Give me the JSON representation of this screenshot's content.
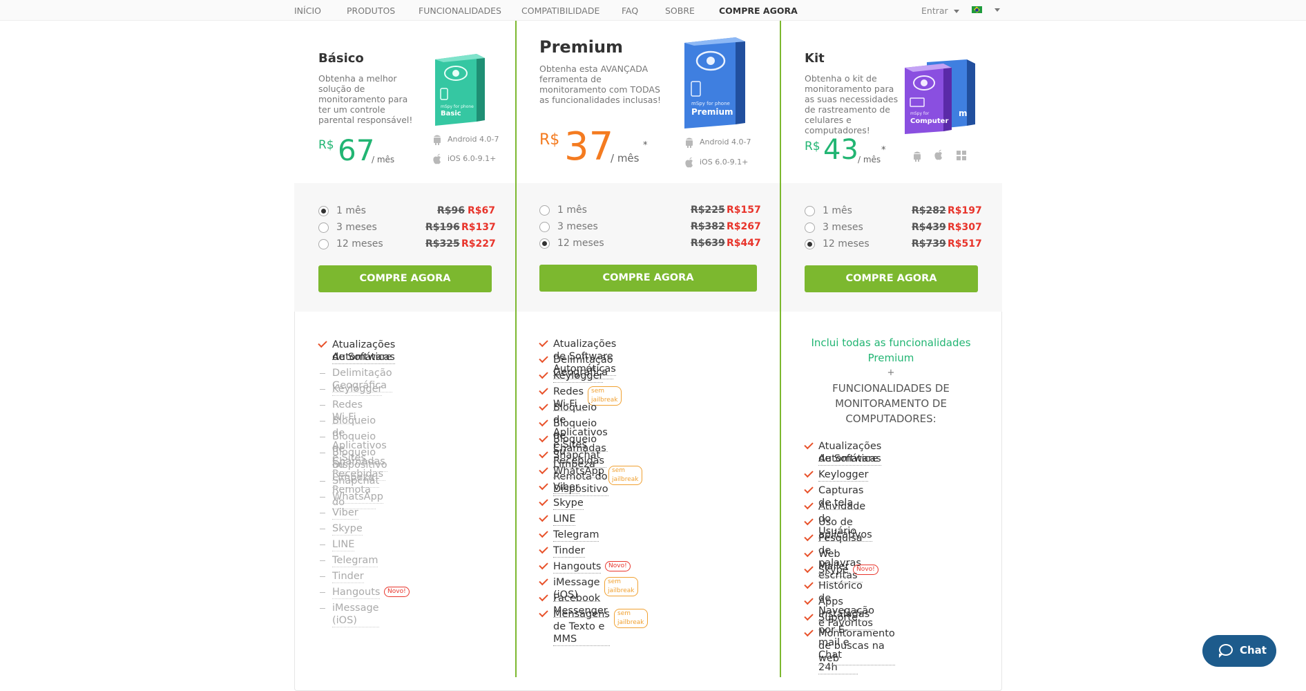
{
  "nav": {
    "links": [
      "INÍCIO",
      "PRODUTOS",
      "FUNCIONALIDADES",
      "COMPATIBILIDADE",
      "FAQ",
      "SOBRE",
      "COMPRE AGORA"
    ],
    "login": "Entrar",
    "flag_colors": {
      "green": "#1f9b3c",
      "yellow": "#f6d70f",
      "blue": "#1b3f98"
    }
  },
  "colors": {
    "accent_green": "#7cb82f",
    "price_green": "#22b573",
    "price_orange": "#f47b20",
    "sale_red": "#e8342b",
    "check_orange": "#e8522b"
  },
  "plans": {
    "basic": {
      "title": "Básico",
      "desc": [
        "Obtenha a melhor",
        "solução de",
        "monitoramento para",
        "ter um controle",
        "parental responsável!"
      ],
      "currency": "R$",
      "price": "67",
      "per": "/ mês",
      "os": [
        "Android 4.0-7",
        "iOS 6.0-9.1+"
      ],
      "box_label": {
        "brand": "mSpy for phone",
        "name": "Basic"
      },
      "options": [
        {
          "label": "1 mês",
          "old": "R$96",
          "new": "R$67",
          "selected": true
        },
        {
          "label": "3 meses",
          "old": "R$196",
          "new": "R$137",
          "selected": false
        },
        {
          "label": "12 meses",
          "old": "R$325",
          "new": "R$227",
          "selected": false
        }
      ],
      "buy": "COMPRE AGORA",
      "features": [
        {
          "text": "Atualizações de Software",
          "text2": "Automáticas",
          "on": true
        },
        {
          "text": "Delimitação Geográfica",
          "on": false
        },
        {
          "text": "Keylogger",
          "on": false
        },
        {
          "text": "Redes Wi-Fi",
          "on": false
        },
        {
          "text": "Bloqueio de Aplicativos e Sites",
          "on": false
        },
        {
          "text": "Bloqueio de Chamadas Recebidas",
          "on": false
        },
        {
          "text": "Bloqueio ou Limpeza Remota do",
          "text2": "Dispositivo",
          "on": false
        },
        {
          "text": "Snapchat",
          "on": false
        },
        {
          "text": "WhatsApp",
          "on": false
        },
        {
          "text": "Viber",
          "on": false
        },
        {
          "text": "Skype",
          "on": false
        },
        {
          "text": "LINE",
          "on": false
        },
        {
          "text": "Telegram",
          "on": false
        },
        {
          "text": "Tinder",
          "on": false
        },
        {
          "text": "Hangouts",
          "on": false,
          "badge": "Novo!"
        },
        {
          "text": "iMessage (iOS)",
          "on": false
        }
      ]
    },
    "premium": {
      "title": "Premium",
      "desc": [
        "Obtenha esta AVANÇADA",
        "ferramenta de",
        "monitoramento com TODAS",
        "as funcionalidades inclusas!"
      ],
      "currency": "R$",
      "price": "37",
      "per": "/ mês",
      "star": "*",
      "os": [
        "Android 4.0-7",
        "iOS 6.0-9.1+"
      ],
      "box_label": {
        "brand": "mSpy for phone",
        "name": "Premium"
      },
      "options": [
        {
          "label": "1 mês",
          "old": "R$225",
          "new": "R$157",
          "selected": false
        },
        {
          "label": "3 meses",
          "old": "R$382",
          "new": "R$267",
          "selected": false
        },
        {
          "label": "12 meses",
          "old": "R$639",
          "new": "R$447",
          "selected": true
        }
      ],
      "buy": "COMPRE AGORA",
      "features": [
        {
          "text": "Atualizações de Software Automáticas"
        },
        {
          "text": "Delimitação Geográfica"
        },
        {
          "text": "Keylogger"
        },
        {
          "text": "Redes Wi-Fi",
          "nj": "sem jailbreak"
        },
        {
          "text": "Bloqueio de Aplicativos e Sites"
        },
        {
          "text": "Bloqueio de Chamadas Recebidas"
        },
        {
          "text": "Bloqueio ou Limpeza Remota do Dispositivo"
        },
        {
          "text": "Snapchat"
        },
        {
          "text": "WhatsApp",
          "nj": "sem jailbreak"
        },
        {
          "text": "Viber"
        },
        {
          "text": "Skype"
        },
        {
          "text": "LINE"
        },
        {
          "text": "Telegram"
        },
        {
          "text": "Tinder"
        },
        {
          "text": "Hangouts",
          "badge": "Novo!"
        },
        {
          "text": "iMessage (iOS)",
          "nj": "sem jailbreak"
        },
        {
          "text": "Facebook Messenger"
        },
        {
          "text": "Mensagens de Texto e MMS",
          "nj": "sem jailbreak"
        }
      ]
    },
    "kit": {
      "title": "Kit",
      "desc": [
        "Obtenha o kit de",
        "monitoramento para",
        "as suas necessidades",
        "de rastreamento de",
        "celulares e",
        "computadores!"
      ],
      "currency": "R$",
      "price": "43",
      "per": "/ mês",
      "star": "*",
      "box_label": {
        "brand": "mSpy for",
        "name": "Computer",
        "back": "m"
      },
      "options": [
        {
          "label": "1 mês",
          "old": "R$282",
          "new": "R$197",
          "selected": false
        },
        {
          "label": "3 meses",
          "old": "R$439",
          "new": "R$307",
          "selected": false
        },
        {
          "label": "12 meses",
          "old": "R$739",
          "new": "R$517",
          "selected": true
        }
      ],
      "buy": "COMPRE AGORA",
      "intro_green": [
        "Inclui todas as funcionalidades",
        "Premium"
      ],
      "intro_plus": "+",
      "intro_upper": [
        "FUNCIONALIDADES DE",
        "MONITORAMENTO DE",
        "COMPUTADORES:"
      ],
      "features": [
        {
          "text": "Atualizações de Software",
          "text2": "Automáticas"
        },
        {
          "text": "Keylogger"
        },
        {
          "text": "Capturas de tela"
        },
        {
          "text": "Atividade do Usuário"
        },
        {
          "text": "Uso de aplicativos"
        },
        {
          "text": "Pesquisa de palavras escritas"
        },
        {
          "text": "Web Mailer"
        },
        {
          "text": "Skype",
          "badge": "Novo!"
        },
        {
          "text": "Histórico de Navegação e Favoritos"
        },
        {
          "text": "Apps Instaladas"
        },
        {
          "text": "Suporte por E-mail e Chat 24h"
        },
        {
          "text": "Monitoramento de buscas na web"
        }
      ]
    }
  },
  "chat": {
    "label": "Chat"
  }
}
